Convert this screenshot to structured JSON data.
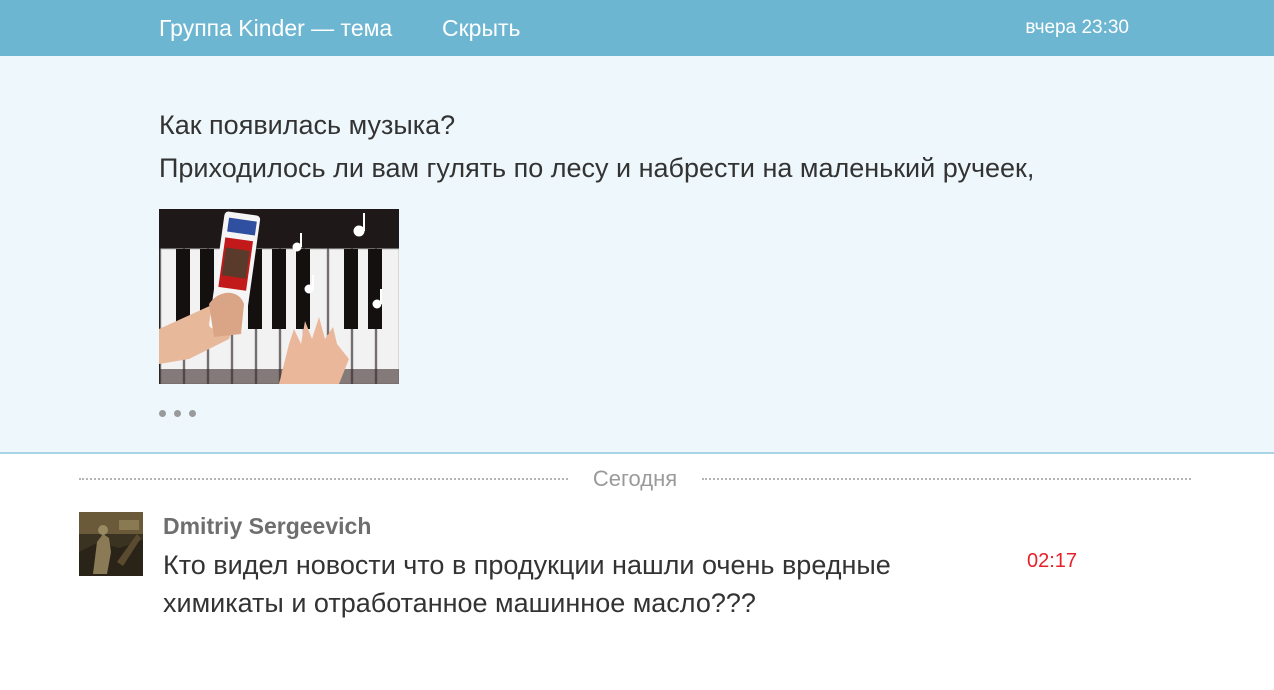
{
  "header": {
    "title": "Группа Kinder — тема",
    "hide_label": "Скрыть",
    "time": "вчера 23:30"
  },
  "topic": {
    "line1": "Как появилась музыка?",
    "line2": "Приходилось ли вам гулять по лесу и набрести на маленький ручеек,",
    "more_icon": "ellipsis-icon"
  },
  "divider": {
    "label": "Сегодня"
  },
  "comment": {
    "author": "Dmitriy Sergeevich",
    "text": "Кто видел новости что в продукции нашли очень вредные химикаты и отработанное машинное масло???",
    "time": "02:17",
    "time_color": "#e8202a"
  },
  "colors": {
    "header_bg": "#6db6d2",
    "topic_bg": "#eef7fb"
  }
}
